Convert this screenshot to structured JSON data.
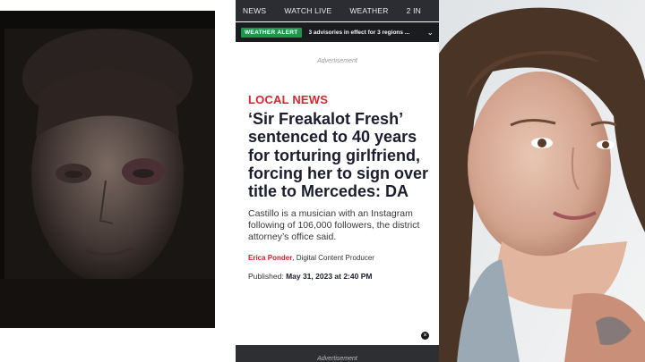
{
  "nav": {
    "items": [
      "NEWS",
      "WATCH LIVE",
      "WEATHER",
      "2 IN"
    ]
  },
  "alert": {
    "badge": "WEATHER ALERT",
    "text": "3 advisories in effect for 3 regions ..."
  },
  "ads": {
    "top_label": "Advertisement",
    "bottom_label": "Advertisement"
  },
  "article": {
    "section": "LOCAL NEWS",
    "headline": "‘Sir Freakalot Fresh’ sentenced to 40 years for torturing girlfriend, forcing her to sign over title to Mercedes: DA",
    "dek": "Castillo is a musician with an Instagram following of 106,000 followers, the district attorney’s office said.",
    "author": "Erica Ponder",
    "author_role": ", Digital Content Producer",
    "published_label": "Published: ",
    "published_value": "May 31, 2023 at 2:40 PM"
  },
  "colors": {
    "nav_bg": "#2b2d33",
    "alert_badge": "#179b4b",
    "accent_red": "#d7262e",
    "headline": "#1a1d2e"
  },
  "icons": {
    "alert_chevron": "chevron-down-icon",
    "ad_close": "close-icon"
  }
}
